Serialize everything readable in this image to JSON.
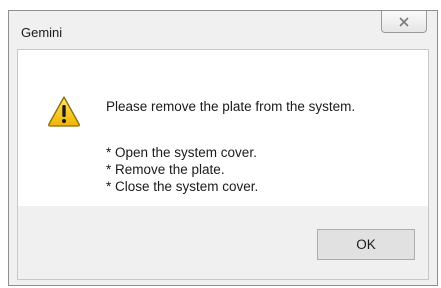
{
  "window": {
    "title": "Gemini",
    "close_icon": "close-x-icon"
  },
  "dialog": {
    "icon": "warning-icon",
    "message": "Please remove the plate from the system.",
    "steps": [
      "* Open the system cover.",
      "* Remove the plate.",
      "* Close the system cover."
    ]
  },
  "buttons": {
    "ok_label": "OK"
  },
  "colors": {
    "warning_fill": "#f5c400",
    "warning_border": "#8a6d00",
    "frame_bg": "#f0f0f0",
    "content_bg": "#ffffff"
  }
}
